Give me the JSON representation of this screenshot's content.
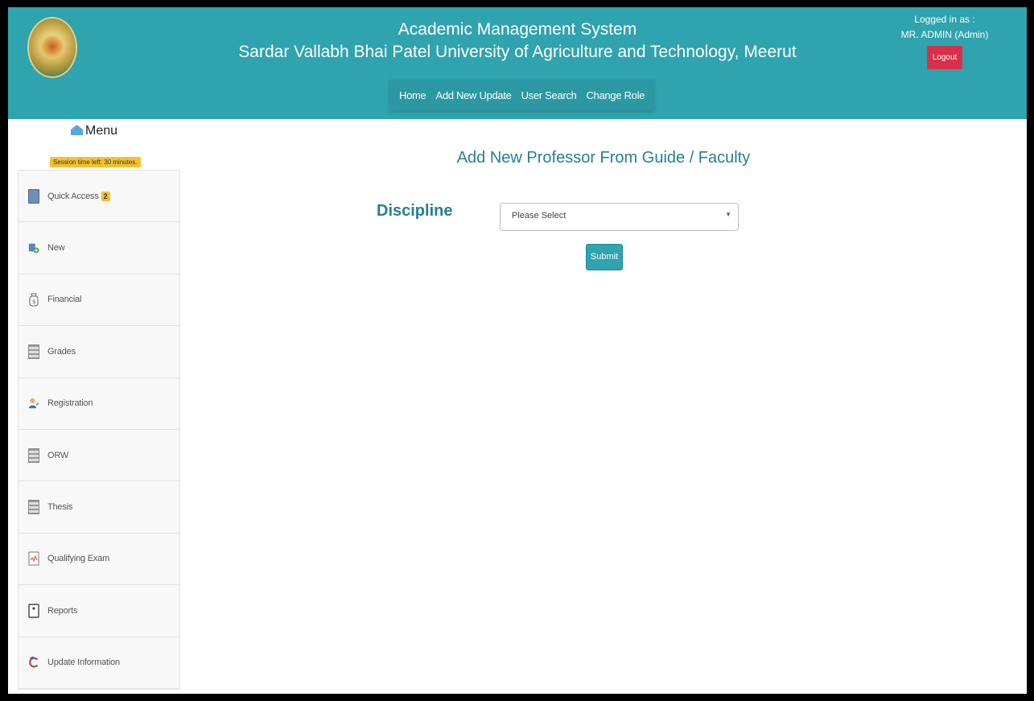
{
  "header": {
    "title": "Academic Management System",
    "university": "Sardar Vallabh Bhai Patel University of Agriculture and Technology, Meerut",
    "nav": [
      "Home",
      "Add New Update",
      "User Search",
      "Change Role"
    ],
    "logged_in_label": "Logged in as :",
    "user": "MR. ADMIN (Admin)",
    "logout": "Logout"
  },
  "sidebar": {
    "menu_label": "Menu",
    "session": "Session time left: 30 minutes.",
    "items": [
      {
        "label": "Quick Access",
        "badge": "2",
        "icon": "quick-access-icon"
      },
      {
        "label": "New",
        "icon": "new-icon"
      },
      {
        "label": "Financial",
        "icon": "financial-icon"
      },
      {
        "label": "Grades",
        "icon": "grades-icon"
      },
      {
        "label": "Registration",
        "icon": "registration-icon"
      },
      {
        "label": "ORW",
        "icon": "orw-icon"
      },
      {
        "label": "Thesis",
        "icon": "thesis-icon"
      },
      {
        "label": "Qualifying Exam",
        "icon": "qualifying-exam-icon"
      },
      {
        "label": "Reports",
        "icon": "reports-icon"
      },
      {
        "label": "Update Information",
        "icon": "update-information-icon"
      }
    ]
  },
  "main": {
    "title": "Add New Professor From Guide / Faculty",
    "discipline_label": "Discipline",
    "discipline_value": "Please Select",
    "submit": "Submit"
  },
  "colors": {
    "header_bg": "#2fa3ae",
    "logout_bg": "#d9304a",
    "accent_text": "#2a7f8e",
    "badge": "#f4c22b"
  }
}
